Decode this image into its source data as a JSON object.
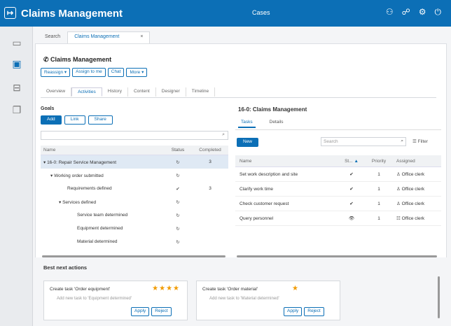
{
  "app": {
    "title": "Claims Management",
    "center_label": "Cases"
  },
  "colors": {
    "brand": "#0c6fb6",
    "selected_row": "#dfe9f4",
    "stars": "#f19b00"
  },
  "topbar_icons": [
    "sitemap-icon",
    "network-icon",
    "gear-icon",
    "power-icon"
  ],
  "leftnav": [
    "inbox-icon",
    "briefcase-icon",
    "hierarchy-icon",
    "documents-icon"
  ],
  "doc_tabs": [
    {
      "label": "Search"
    },
    {
      "label": "Claims Management",
      "close": "×"
    }
  ],
  "page": {
    "title": "Claims Management",
    "actions": [
      "Reassign ▾",
      "Assign to me",
      "Chat",
      "More ▾"
    ],
    "tabs": [
      "Overview",
      "Activities",
      "History",
      "Content",
      "Designer",
      "Timeline"
    ],
    "active_tab": "Activities"
  },
  "goals": {
    "title": "Goals",
    "buttons": [
      "Add",
      "Link",
      "Share"
    ],
    "columns": [
      "Name",
      "Status",
      "Completed"
    ],
    "rows": [
      {
        "name": "▾ 16-0: Repair Service Management",
        "status": "↻",
        "completed": "3"
      },
      {
        "name": "▾ Working order submitted",
        "status": "↻",
        "completed": ""
      },
      {
        "name": "Requirements defined",
        "status": "✔",
        "completed": "3"
      },
      {
        "name": "▾ Services defined",
        "status": "↻",
        "completed": ""
      },
      {
        "name": "Service team determined",
        "status": "↻",
        "completed": ""
      },
      {
        "name": "Equipment determined",
        "status": "↻",
        "completed": ""
      },
      {
        "name": "Material determined",
        "status": "↻",
        "completed": ""
      }
    ]
  },
  "right": {
    "title": "16-0: Claims Management",
    "tabs": [
      "Tasks",
      "Details"
    ],
    "new_button": "New",
    "search_placeholder": "Search",
    "filter_label": "Filter",
    "columns": [
      "Name",
      "St...",
      "Priority",
      "Assigned"
    ],
    "rows": [
      {
        "name": "Set work description and site",
        "status": "✔",
        "priority": "1",
        "assigned": "Office clerk"
      },
      {
        "name": "Clarify work time",
        "status": "✔",
        "priority": "1",
        "assigned": "Office clerk"
      },
      {
        "name": "Check customer request",
        "status": "✔",
        "priority": "1",
        "assigned": "Office clerk"
      },
      {
        "name": "Query personnel",
        "status": "👁",
        "priority": "1",
        "assigned": "Office clerk"
      }
    ]
  },
  "best_next": {
    "title": "Best next actions",
    "cards": [
      {
        "title": "Create task 'Order equipment'",
        "stars": "★★★★",
        "rating": 4,
        "desc": "Add new task to 'Equipment determined'",
        "apply": "Apply",
        "reject": "Reject"
      },
      {
        "title": "Create task 'Order material'",
        "stars": "★",
        "rating": 1,
        "desc": "Add new task to 'Material determined'",
        "apply": "Apply",
        "reject": "Reject"
      }
    ]
  }
}
